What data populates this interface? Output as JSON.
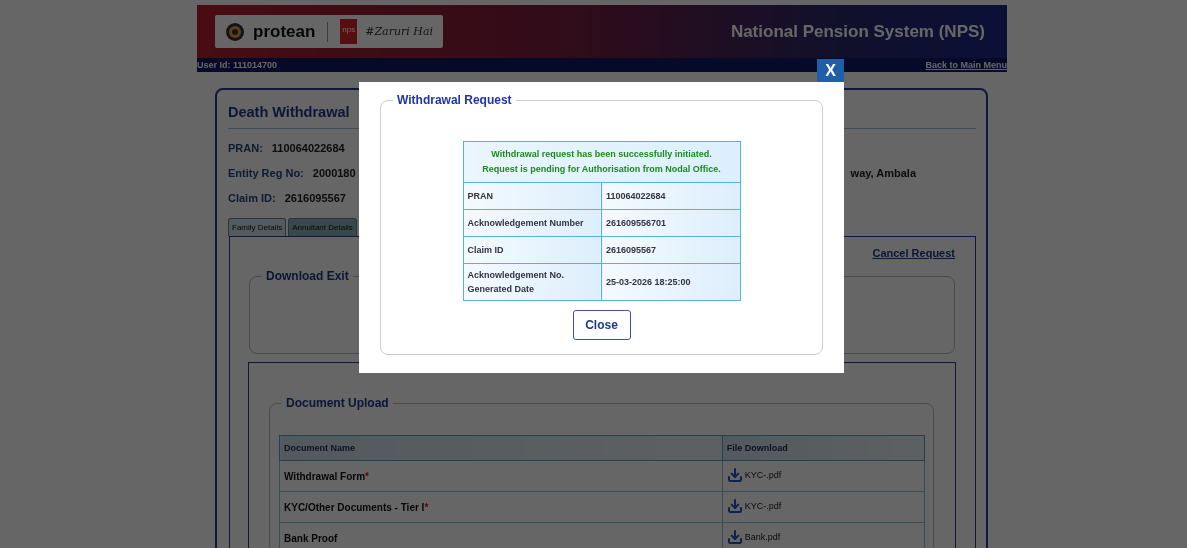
{
  "header": {
    "brand": "protean",
    "badge_top": "nps",
    "tagline": "#Zaruri Hai",
    "title": "National Pension System (NPS)"
  },
  "user_bar": {
    "user_id": "User Id: 111014700",
    "back_link": "Back to Main Menu"
  },
  "page": {
    "title": "Death Withdrawal",
    "fields": [
      {
        "label": "PRAN:",
        "value": "110064022684"
      },
      {
        "label": "Entity Reg No:",
        "value": "2000180",
        "extra": "way, Ambala"
      },
      {
        "label": "Claim ID:",
        "value": "2616095567"
      }
    ],
    "tabs": [
      {
        "label": "Family Details",
        "selected": true
      },
      {
        "label": "Annuitant Details",
        "selected": false
      }
    ],
    "cancel_link": "Cancel Request",
    "download_section": "Download Exit",
    "document_upload": {
      "title": "Document Upload",
      "columns": [
        "Document Name",
        "File Download"
      ],
      "rows": [
        {
          "name": "Withdrawal Form",
          "mark": "*",
          "file": "KYC-.pdf"
        },
        {
          "name": "KYC/Other Documents - Tier I",
          "mark": "*",
          "file": "KYC-.pdf"
        },
        {
          "name": "Bank Proof",
          "file": "Bank.pdf"
        }
      ]
    }
  },
  "dialog": {
    "close_button": "X",
    "title": "Withdrawal Request",
    "message": [
      "Withdrawal request has been successfully initiated.",
      "Request is pending for Authorisation from Nodal Office."
    ],
    "rows": [
      {
        "label": "PRAN",
        "value": "110064022684"
      },
      {
        "label": "Acknowledgement Number",
        "value": "261609556701"
      },
      {
        "label": "Claim ID",
        "value": "2616095567"
      },
      {
        "label": "Acknowledgement No. Generated Date",
        "value": "25-03-2026 18:25:00"
      }
    ],
    "button": "Close"
  }
}
